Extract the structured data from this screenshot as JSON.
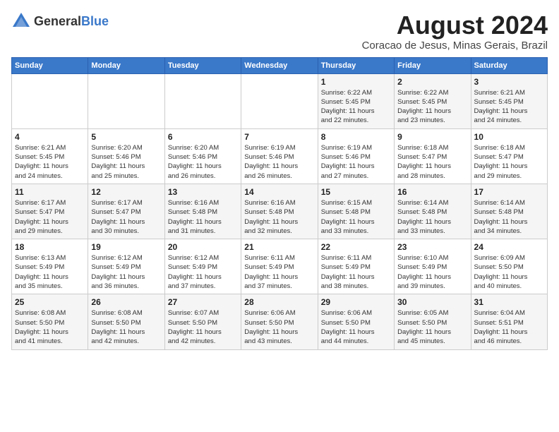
{
  "logo": {
    "general": "General",
    "blue": "Blue"
  },
  "title": {
    "month_year": "August 2024",
    "location": "Coracao de Jesus, Minas Gerais, Brazil"
  },
  "weekdays": [
    "Sunday",
    "Monday",
    "Tuesday",
    "Wednesday",
    "Thursday",
    "Friday",
    "Saturday"
  ],
  "weeks": [
    [
      {
        "day": "",
        "info": ""
      },
      {
        "day": "",
        "info": ""
      },
      {
        "day": "",
        "info": ""
      },
      {
        "day": "",
        "info": ""
      },
      {
        "day": "1",
        "info": "Sunrise: 6:22 AM\nSunset: 5:45 PM\nDaylight: 11 hours\nand 22 minutes."
      },
      {
        "day": "2",
        "info": "Sunrise: 6:22 AM\nSunset: 5:45 PM\nDaylight: 11 hours\nand 23 minutes."
      },
      {
        "day": "3",
        "info": "Sunrise: 6:21 AM\nSunset: 5:45 PM\nDaylight: 11 hours\nand 24 minutes."
      }
    ],
    [
      {
        "day": "4",
        "info": "Sunrise: 6:21 AM\nSunset: 5:45 PM\nDaylight: 11 hours\nand 24 minutes."
      },
      {
        "day": "5",
        "info": "Sunrise: 6:20 AM\nSunset: 5:46 PM\nDaylight: 11 hours\nand 25 minutes."
      },
      {
        "day": "6",
        "info": "Sunrise: 6:20 AM\nSunset: 5:46 PM\nDaylight: 11 hours\nand 26 minutes."
      },
      {
        "day": "7",
        "info": "Sunrise: 6:19 AM\nSunset: 5:46 PM\nDaylight: 11 hours\nand 26 minutes."
      },
      {
        "day": "8",
        "info": "Sunrise: 6:19 AM\nSunset: 5:46 PM\nDaylight: 11 hours\nand 27 minutes."
      },
      {
        "day": "9",
        "info": "Sunrise: 6:18 AM\nSunset: 5:47 PM\nDaylight: 11 hours\nand 28 minutes."
      },
      {
        "day": "10",
        "info": "Sunrise: 6:18 AM\nSunset: 5:47 PM\nDaylight: 11 hours\nand 29 minutes."
      }
    ],
    [
      {
        "day": "11",
        "info": "Sunrise: 6:17 AM\nSunset: 5:47 PM\nDaylight: 11 hours\nand 29 minutes."
      },
      {
        "day": "12",
        "info": "Sunrise: 6:17 AM\nSunset: 5:47 PM\nDaylight: 11 hours\nand 30 minutes."
      },
      {
        "day": "13",
        "info": "Sunrise: 6:16 AM\nSunset: 5:48 PM\nDaylight: 11 hours\nand 31 minutes."
      },
      {
        "day": "14",
        "info": "Sunrise: 6:16 AM\nSunset: 5:48 PM\nDaylight: 11 hours\nand 32 minutes."
      },
      {
        "day": "15",
        "info": "Sunrise: 6:15 AM\nSunset: 5:48 PM\nDaylight: 11 hours\nand 33 minutes."
      },
      {
        "day": "16",
        "info": "Sunrise: 6:14 AM\nSunset: 5:48 PM\nDaylight: 11 hours\nand 33 minutes."
      },
      {
        "day": "17",
        "info": "Sunrise: 6:14 AM\nSunset: 5:48 PM\nDaylight: 11 hours\nand 34 minutes."
      }
    ],
    [
      {
        "day": "18",
        "info": "Sunrise: 6:13 AM\nSunset: 5:49 PM\nDaylight: 11 hours\nand 35 minutes."
      },
      {
        "day": "19",
        "info": "Sunrise: 6:12 AM\nSunset: 5:49 PM\nDaylight: 11 hours\nand 36 minutes."
      },
      {
        "day": "20",
        "info": "Sunrise: 6:12 AM\nSunset: 5:49 PM\nDaylight: 11 hours\nand 37 minutes."
      },
      {
        "day": "21",
        "info": "Sunrise: 6:11 AM\nSunset: 5:49 PM\nDaylight: 11 hours\nand 37 minutes."
      },
      {
        "day": "22",
        "info": "Sunrise: 6:11 AM\nSunset: 5:49 PM\nDaylight: 11 hours\nand 38 minutes."
      },
      {
        "day": "23",
        "info": "Sunrise: 6:10 AM\nSunset: 5:49 PM\nDaylight: 11 hours\nand 39 minutes."
      },
      {
        "day": "24",
        "info": "Sunrise: 6:09 AM\nSunset: 5:50 PM\nDaylight: 11 hours\nand 40 minutes."
      }
    ],
    [
      {
        "day": "25",
        "info": "Sunrise: 6:08 AM\nSunset: 5:50 PM\nDaylight: 11 hours\nand 41 minutes."
      },
      {
        "day": "26",
        "info": "Sunrise: 6:08 AM\nSunset: 5:50 PM\nDaylight: 11 hours\nand 42 minutes."
      },
      {
        "day": "27",
        "info": "Sunrise: 6:07 AM\nSunset: 5:50 PM\nDaylight: 11 hours\nand 42 minutes."
      },
      {
        "day": "28",
        "info": "Sunrise: 6:06 AM\nSunset: 5:50 PM\nDaylight: 11 hours\nand 43 minutes."
      },
      {
        "day": "29",
        "info": "Sunrise: 6:06 AM\nSunset: 5:50 PM\nDaylight: 11 hours\nand 44 minutes."
      },
      {
        "day": "30",
        "info": "Sunrise: 6:05 AM\nSunset: 5:50 PM\nDaylight: 11 hours\nand 45 minutes."
      },
      {
        "day": "31",
        "info": "Sunrise: 6:04 AM\nSunset: 5:51 PM\nDaylight: 11 hours\nand 46 minutes."
      }
    ]
  ]
}
